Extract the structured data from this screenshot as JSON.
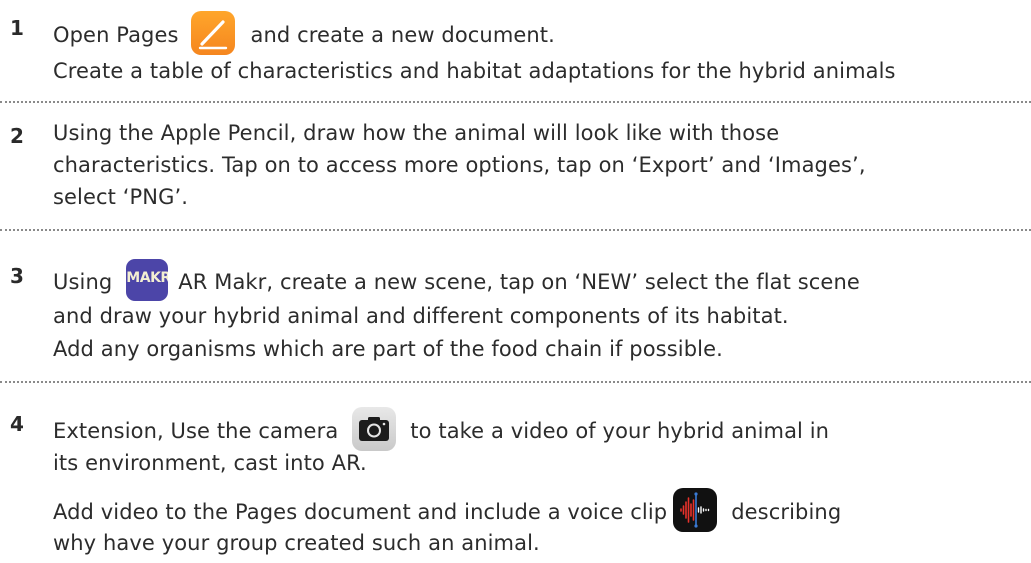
{
  "steps": [
    {
      "number": "1",
      "lines": [
        {
          "before": "Open Pages",
          "icon": "pages-icon",
          "after": "and create a new document."
        },
        {
          "text": "Create a table of characteristics and habitat adaptations for the hybrid animals"
        }
      ]
    },
    {
      "number": "2",
      "lines": [
        {
          "text": "Using the Apple Pencil, draw how the animal will look like with those"
        },
        {
          "text": "characteristics. Tap on to access more options, tap on ‘Export’ and ‘Images’,"
        },
        {
          "text": "select ‘PNG’."
        }
      ]
    },
    {
      "number": "3",
      "lines": [
        {
          "before": "Using",
          "icon": "ar-makr-icon",
          "icon_text": "MAKR",
          "after": "AR Makr, create a new scene, tap on ‘NEW’ select the flat scene"
        },
        {
          "text": "and draw your hybrid animal and different components of its habitat."
        },
        {
          "text": "Add any organisms which are part of the food chain if possible."
        }
      ]
    },
    {
      "number": "4",
      "lines": [
        {
          "before": "Extension, Use the camera",
          "icon": "camera-icon",
          "after": "to take a video of your hybrid animal in"
        },
        {
          "text": "its environment, cast into AR."
        },
        {
          "before": "Add video to the Pages document and include a voice clip",
          "icon": "voice-memos-icon",
          "after": "describing"
        },
        {
          "text": "why have your group created such an animal."
        }
      ]
    }
  ],
  "colors": {
    "pages_orange": "#f5861f",
    "ar_makr_purple": "#4c45a8",
    "voice_red": "#e8322b",
    "voice_blue": "#3a7bd5",
    "divider": "#8a8a8a",
    "text": "#2c2c2c"
  }
}
